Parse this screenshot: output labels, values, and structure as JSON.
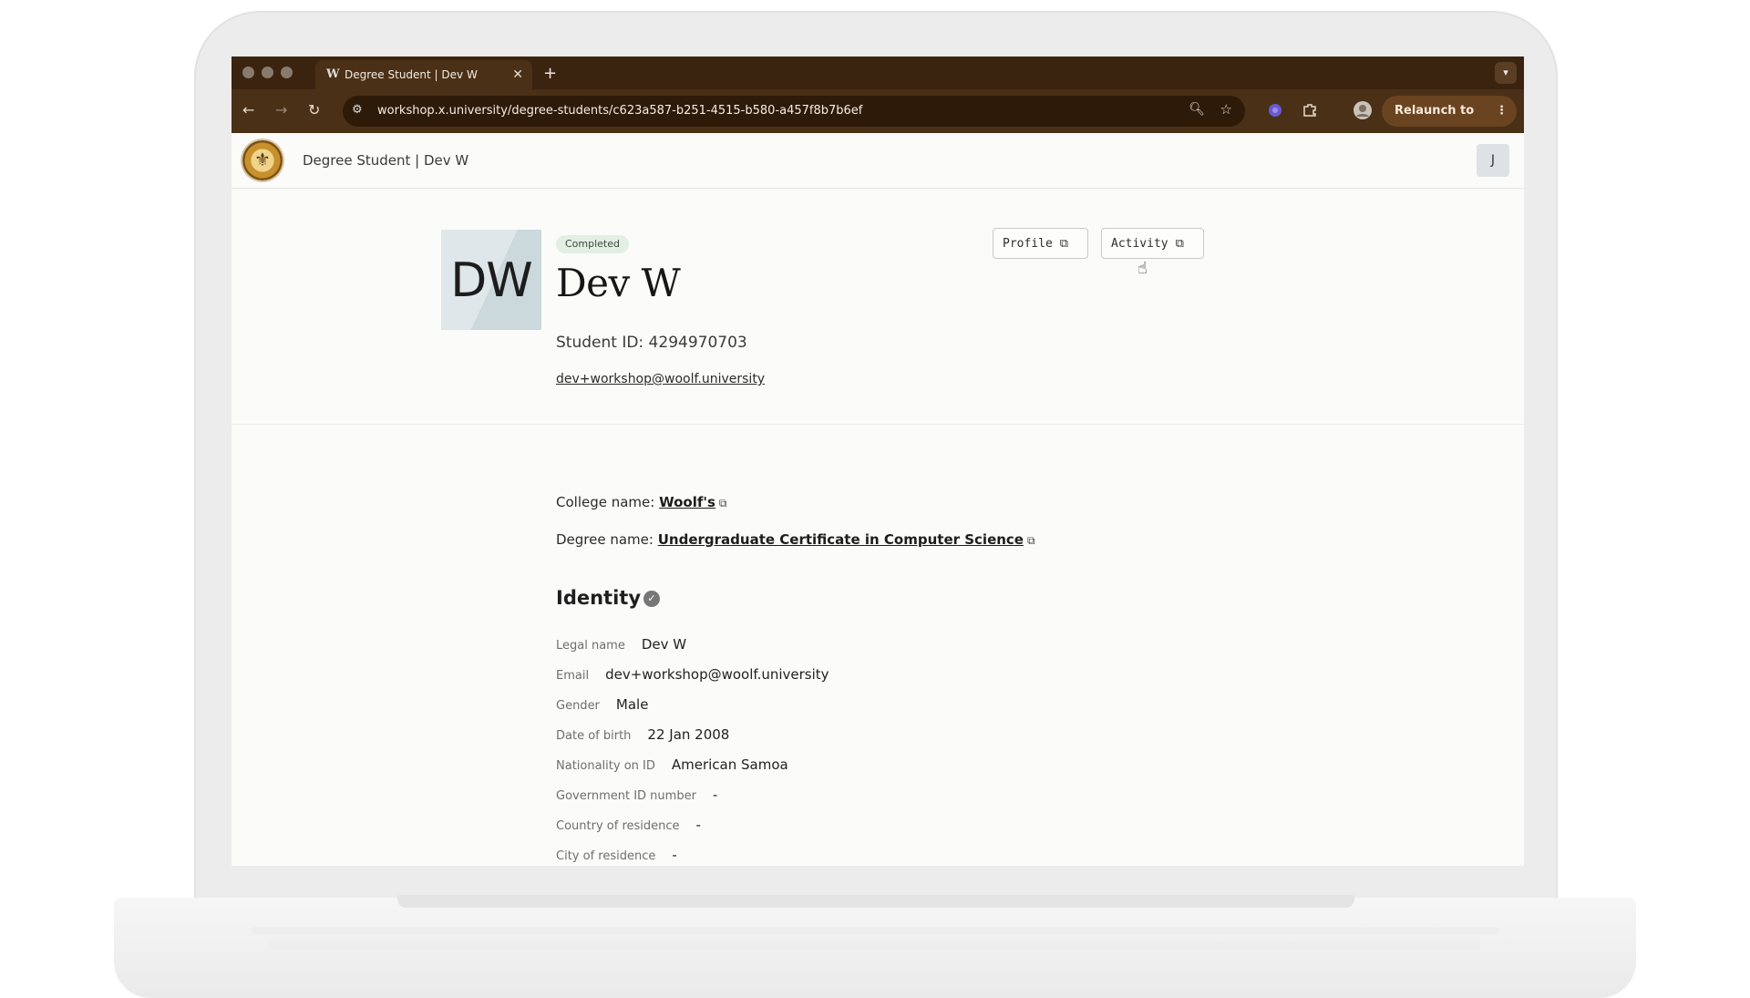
{
  "browser": {
    "tab_title": "Degree Student | Dev W",
    "tab_favicon": "W",
    "url": "workshop.x.university/degree-students/c623a587-b251-4515-b580-a457f8b7b6ef",
    "relaunch_label": "Relaunch to update"
  },
  "app": {
    "title": "Degree Student | Dev W",
    "user_initial": "J"
  },
  "student": {
    "initials": "DW",
    "status": "Completed",
    "name": "Dev W",
    "student_id": "Student ID: 4294970703",
    "email": "dev+workshop@woolf.university"
  },
  "actions": {
    "profile_label": "Profile",
    "activity_label": "Activity"
  },
  "details": {
    "college_label": "College name:",
    "college_value": "Woolf's",
    "degree_label": "Degree name:",
    "degree_value": "Undergraduate Certificate in Computer Science"
  },
  "identity": {
    "heading": "Identity",
    "rows": [
      {
        "label": "Legal name",
        "value": "Dev W"
      },
      {
        "label": "Email",
        "value": "dev+workshop@woolf.university"
      },
      {
        "label": "Gender",
        "value": "Male"
      },
      {
        "label": "Date of birth",
        "value": "22 Jan 2008"
      },
      {
        "label": "Nationality on ID",
        "value": "American Samoa"
      },
      {
        "label": "Government ID number",
        "value": "-"
      },
      {
        "label": "Country of residence",
        "value": "-"
      },
      {
        "label": "City of residence",
        "value": "-"
      }
    ]
  },
  "colors": {
    "browser_frame": "#3a2410",
    "badge_bg": "#e3efe3",
    "relaunch_bg": "#6a4420"
  }
}
